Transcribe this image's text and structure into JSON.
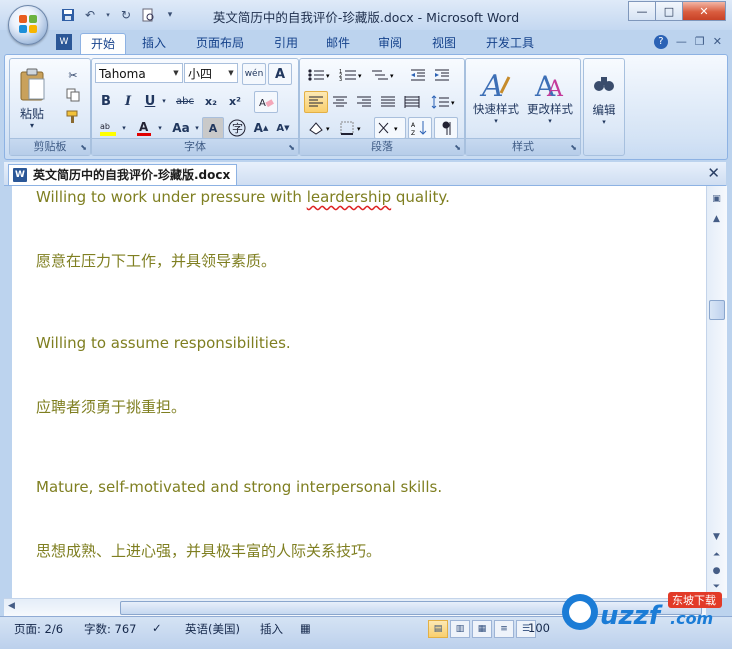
{
  "window": {
    "title": "英文简历中的自我评价-珍藏版.docx - Microsoft Word",
    "buttons": {
      "minimize": "—",
      "maximize": "□",
      "close": "✕"
    }
  },
  "quick_access": [
    "save-icon",
    "undo-icon",
    "redo-icon",
    "print-preview-icon",
    "customize-icon"
  ],
  "ribbon_tabs": [
    "开始",
    "插入",
    "页面布局",
    "引用",
    "邮件",
    "审阅",
    "视图",
    "开发工具"
  ],
  "active_tab": "开始",
  "ribbon": {
    "clipboard": {
      "label": "剪贴板",
      "paste": "粘贴"
    },
    "font": {
      "label": "字体",
      "font_name": "Tahoma",
      "font_size": "小四",
      "buttons": [
        "B",
        "I",
        "U",
        "abc",
        "x₂",
        "x²",
        "Aa",
        "A"
      ]
    },
    "paragraph": {
      "label": "段落"
    },
    "styles": {
      "label": "样式",
      "quick_styles": "快速样式",
      "change_styles": "更改样式"
    },
    "editing": {
      "label": "编辑"
    }
  },
  "document_tab": {
    "title": "英文简历中的自我评价-珍藏版.docx"
  },
  "document": {
    "lines": [
      {
        "text_before": "Willing to work under pressure with ",
        "underlined": "leardership",
        "text_after": " quality."
      },
      {
        "text": "愿意在压力下工作，并具领导素质。"
      },
      {
        "text": "Willing to assume responsibilities."
      },
      {
        "text": "应聘者须勇于挑重担。"
      },
      {
        "text": "Mature, self-motivated and strong interpersonal skills."
      },
      {
        "text": "思想成熟、上进心强，并具极丰富的人际关系技巧。"
      }
    ],
    "text_color": "#7f7f21"
  },
  "status_bar": {
    "page": "页面: 2/6",
    "words": "字数: 767",
    "language": "英语(美国)",
    "mode": "插入",
    "zoom": "100"
  },
  "watermark": {
    "text": "uzzf.com",
    "tag": "东坡下载"
  }
}
